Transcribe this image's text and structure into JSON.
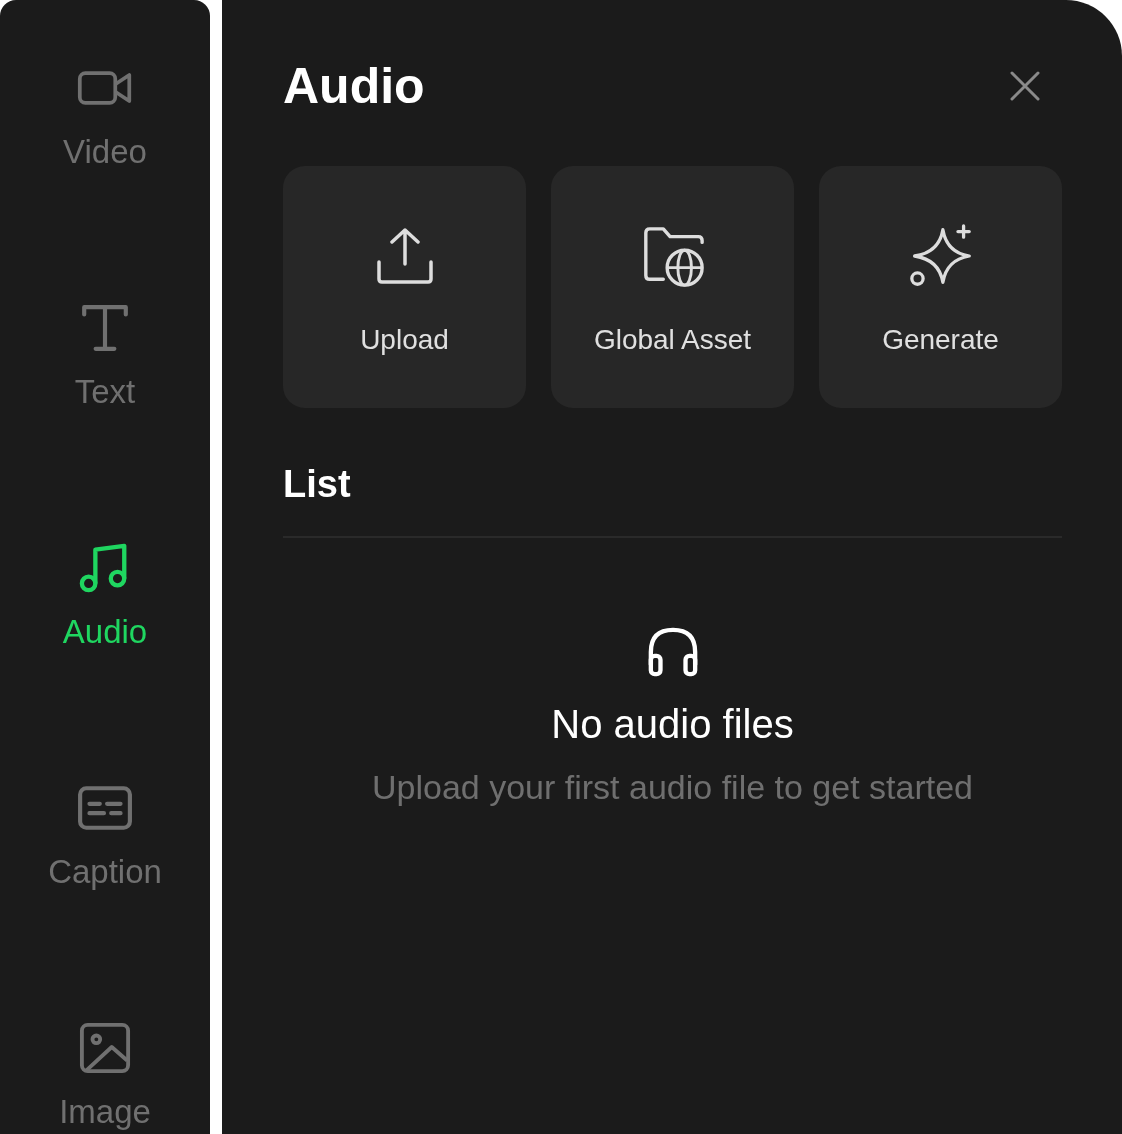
{
  "sidebar": {
    "items": [
      {
        "label": "Video",
        "selected": false
      },
      {
        "label": "Text",
        "selected": false
      },
      {
        "label": "Audio",
        "selected": true
      },
      {
        "label": "Caption",
        "selected": false
      },
      {
        "label": "Image",
        "selected": false
      }
    ]
  },
  "panel": {
    "title": "Audio",
    "actions": [
      {
        "label": "Upload"
      },
      {
        "label": "Global Asset"
      },
      {
        "label": "Generate"
      }
    ],
    "section_title": "List",
    "empty_state": {
      "title": "No audio files",
      "message": "Upload your first audio file to get started"
    }
  }
}
